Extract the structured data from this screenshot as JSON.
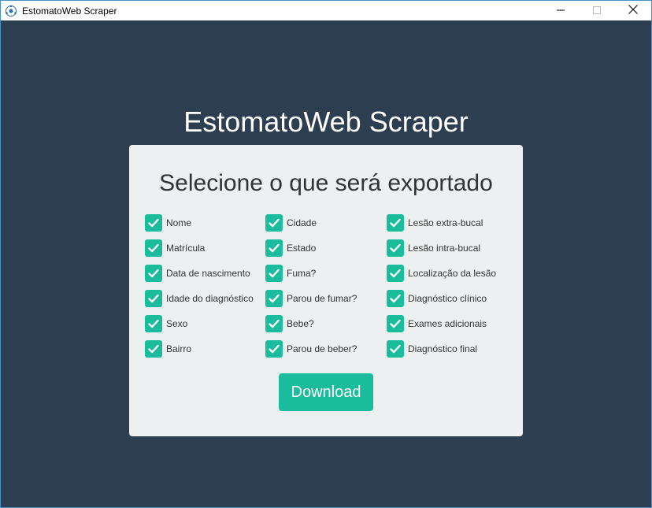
{
  "window": {
    "title": "EstomatoWeb Scraper"
  },
  "header": {
    "app_title": "EstomatoWeb Scraper"
  },
  "card": {
    "title": "Selecione o que será exportado",
    "columns": [
      [
        {
          "label": "Nome",
          "checked": true
        },
        {
          "label": "Matrícula",
          "checked": true
        },
        {
          "label": "Data de nascimento",
          "checked": true
        },
        {
          "label": "Idade do diagnóstico",
          "checked": true
        },
        {
          "label": "Sexo",
          "checked": true
        },
        {
          "label": "Bairro",
          "checked": true
        }
      ],
      [
        {
          "label": "Cidade",
          "checked": true
        },
        {
          "label": "Estado",
          "checked": true
        },
        {
          "label": "Fuma?",
          "checked": true
        },
        {
          "label": "Parou de fumar?",
          "checked": true
        },
        {
          "label": "Bebe?",
          "checked": true
        },
        {
          "label": "Parou de beber?",
          "checked": true
        }
      ],
      [
        {
          "label": "Lesão extra-bucal",
          "checked": true
        },
        {
          "label": "Lesão intra-bucal",
          "checked": true
        },
        {
          "label": "Localização da lesão",
          "checked": true
        },
        {
          "label": "Diagnóstico clínico",
          "checked": true
        },
        {
          "label": "Exames adicionais",
          "checked": true
        },
        {
          "label": "Diagnóstico final",
          "checked": true
        }
      ]
    ],
    "download_label": "Download"
  },
  "colors": {
    "background": "#2c3e50",
    "card": "#ecf0f1",
    "accent": "#1abc9c"
  },
  "icons": {
    "app": "app-icon",
    "minimize": "minimize-icon",
    "maximize": "maximize-icon",
    "close": "close-icon",
    "checkbox": "checkmark-icon"
  }
}
